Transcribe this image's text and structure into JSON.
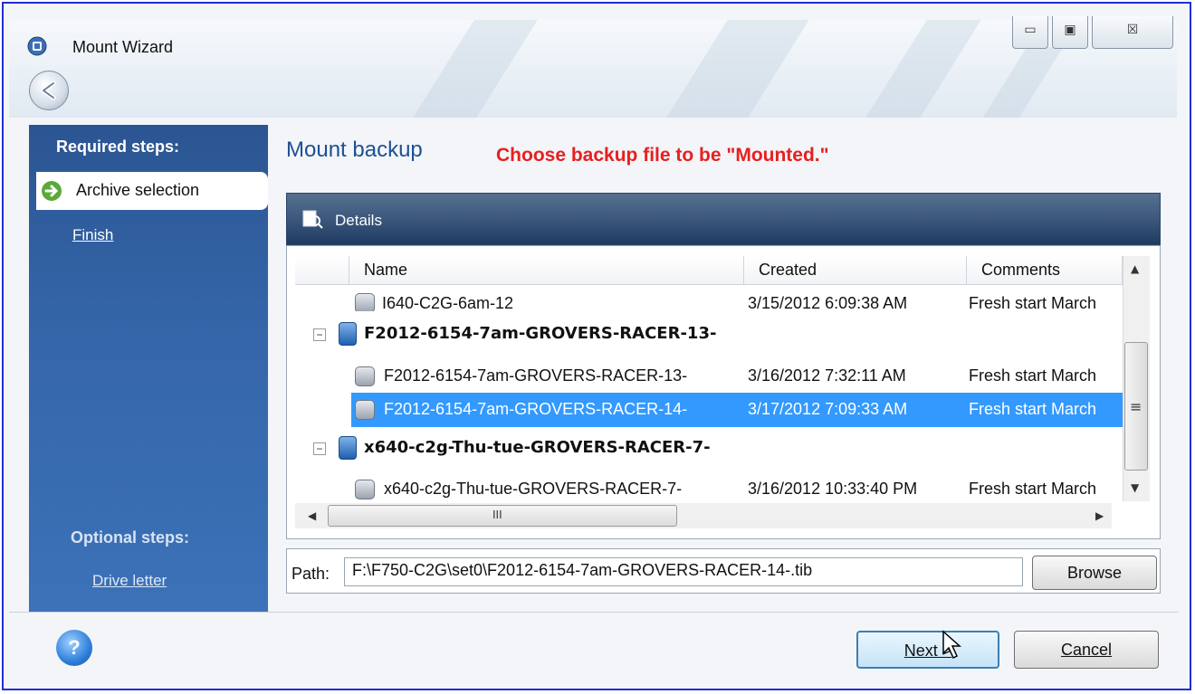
{
  "window": {
    "title": "Mount Wizard",
    "controls": {
      "minimize": "▭",
      "maximize": "▣",
      "close": "☒"
    }
  },
  "sidebar": {
    "required_header": "Required steps:",
    "active_step": "Archive selection",
    "finish": "Finish",
    "optional_header": "Optional steps:",
    "drive_letter": "Drive letter"
  },
  "main": {
    "title": "Mount backup",
    "annotation": "Choose backup file to be \"Mounted.\"",
    "details_label": "Details"
  },
  "grid": {
    "columns": [
      "Name",
      "Created",
      "Comments"
    ],
    "rows": [
      {
        "type": "file",
        "name": "I640-C2G-6am-12",
        "created": "3/15/2012 6:09:38 AM",
        "comment": "Fresh start March"
      },
      {
        "type": "group",
        "name": "F2012-6154-7am-GROVERS-RACER-13-"
      },
      {
        "type": "file",
        "name": "F2012-6154-7am-GROVERS-RACER-13-",
        "created": "3/16/2012 7:32:11 AM",
        "comment": "Fresh start March"
      },
      {
        "type": "file",
        "name": "F2012-6154-7am-GROVERS-RACER-14-",
        "created": "3/17/2012 7:09:33 AM",
        "comment": "Fresh start March",
        "selected": true
      },
      {
        "type": "group",
        "name": "x640-c2g-Thu-tue-GROVERS-RACER-7-"
      },
      {
        "type": "file",
        "name": "x640-c2g-Thu-tue-GROVERS-RACER-7-",
        "created": "3/16/2012 10:33:40 PM",
        "comment": "Fresh start March"
      }
    ],
    "hscroll_grip": "III",
    "vscroll_grip": "≡"
  },
  "path": {
    "label": "Path:",
    "value": "F:\\F750-C2G\\set0\\F2012-6154-7am-GROVERS-RACER-14-.tib",
    "browse": "Browse"
  },
  "footer": {
    "help": "?",
    "next": "Next >",
    "cancel": "Cancel"
  }
}
